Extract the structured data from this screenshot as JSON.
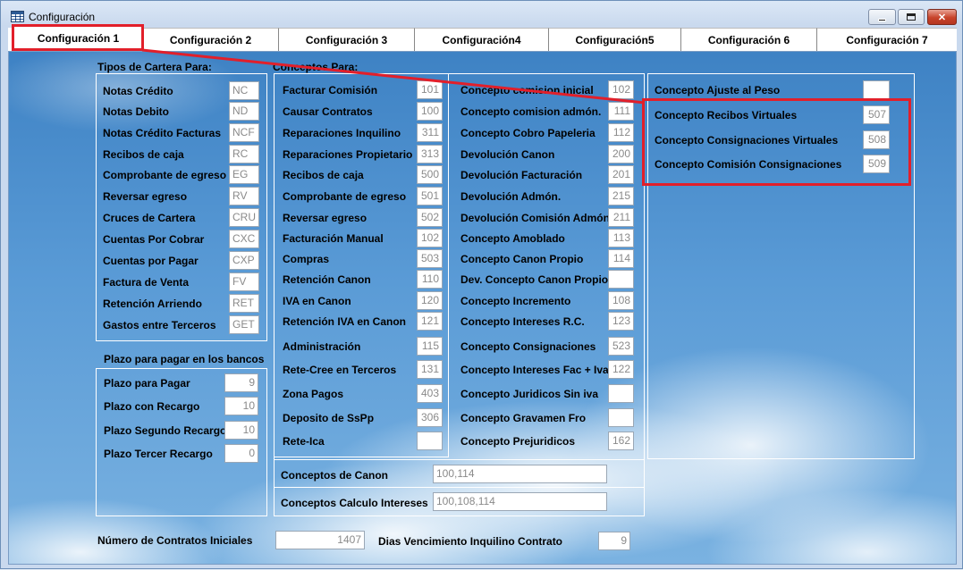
{
  "window": {
    "title": "Configuración"
  },
  "tabs": [
    "Configuración 1",
    "Configuración 2",
    "Configuración 3",
    "Configuración4",
    "Configuración5",
    "Configuración 6",
    "Configuración 7"
  ],
  "tipos_cartera": {
    "title": "Tipos de Cartera Para:",
    "rows": [
      {
        "label": "Notas Crédito",
        "value": "NC"
      },
      {
        "label": "Notas Debito",
        "value": "ND"
      },
      {
        "label": "Notas Crédito Facturas",
        "value": "NCF"
      },
      {
        "label": "Recibos de caja",
        "value": "RC"
      },
      {
        "label": "Comprobante de egreso",
        "value": "EG"
      },
      {
        "label": "Reversar egreso",
        "value": "RV"
      },
      {
        "label": "Cruces de Cartera",
        "value": "CRU"
      },
      {
        "label": "Cuentas Por Cobrar",
        "value": "CXC"
      },
      {
        "label": "Cuentas por Pagar",
        "value": "CXP"
      },
      {
        "label": "Factura de Venta",
        "value": "FV"
      },
      {
        "label": "Retención Arriendo",
        "value": "RET"
      },
      {
        "label": "Gastos entre Terceros",
        "value": "GET"
      }
    ]
  },
  "plazo": {
    "title": "Plazo para pagar en los bancos",
    "rows": [
      {
        "label": "Plazo para Pagar",
        "value": "9"
      },
      {
        "label": "Plazo con Recargo",
        "value": "10"
      },
      {
        "label": "Plazo Segundo Recargo",
        "value": "10"
      },
      {
        "label": "Plazo Tercer Recargo",
        "value": "0"
      }
    ]
  },
  "conceptos": {
    "title": "Conceptos Para:",
    "col1": [
      {
        "label": "Facturar Comisión",
        "value": "101"
      },
      {
        "label": "Causar Contratos",
        "value": "100"
      },
      {
        "label": "Reparaciones Inquilino",
        "value": "311"
      },
      {
        "label": "Reparaciones Propietario",
        "value": "313"
      },
      {
        "label": "Recibos de caja",
        "value": "500"
      },
      {
        "label": "Comprobante de egreso",
        "value": "501"
      },
      {
        "label": "Reversar egreso",
        "value": "502"
      },
      {
        "label": "Facturación Manual",
        "value": "102"
      },
      {
        "label": "Compras",
        "value": "503"
      },
      {
        "label": "Retención Canon",
        "value": "110"
      },
      {
        "label": "IVA en Canon",
        "value": "120"
      },
      {
        "label": "Retención IVA en Canon",
        "value": "121"
      },
      {
        "label": "Administración",
        "value": "115"
      },
      {
        "label": "Rete-Cree en Terceros",
        "value": "131"
      },
      {
        "label": "Zona Pagos",
        "value": "403"
      },
      {
        "label": "Deposito de SsPp",
        "value": "306"
      },
      {
        "label": "Rete-Ica",
        "value": ""
      }
    ],
    "col2": [
      {
        "label": "Concepto comision inicial",
        "value": "102"
      },
      {
        "label": "Concepto comision admón.",
        "value": "111"
      },
      {
        "label": "Concepto Cobro Papeleria",
        "value": "112"
      },
      {
        "label": "Devolución Canon",
        "value": "200"
      },
      {
        "label": "Devolución Facturación",
        "value": "201"
      },
      {
        "label": "Devolución Admón.",
        "value": "215"
      },
      {
        "label": "Devolución Comisión Admón.",
        "value": "211"
      },
      {
        "label": "Concepto Amoblado",
        "value": "113"
      },
      {
        "label": "Concepto Canon Propio",
        "value": "114"
      },
      {
        "label": "Dev. Concepto Canon Propio",
        "value": ""
      },
      {
        "label": "Concepto Incremento",
        "value": "108"
      },
      {
        "label": "Concepto Intereses R.C.",
        "value": "123"
      },
      {
        "label": "Concepto Consignaciones",
        "value": "523"
      },
      {
        "label": "Concepto Intereses Fac + Iva",
        "value": "122"
      },
      {
        "label": "Concepto Juridicos Sin iva",
        "value": ""
      },
      {
        "label": "Concepto Gravamen Fro",
        "value": ""
      },
      {
        "label": "Concepto Prejuridicos",
        "value": "162"
      }
    ],
    "canon": {
      "label": "Conceptos de Canon",
      "value": "100,114"
    },
    "intereses": {
      "label": "Conceptos Calculo Intereses",
      "value": "100,108,114"
    }
  },
  "col3": [
    {
      "label": "Concepto Ajuste al Peso",
      "value": ""
    },
    {
      "label": "Concepto Recibos Virtuales",
      "value": "507"
    },
    {
      "label": "Concepto Consignaciones Virtuales",
      "value": "508"
    },
    {
      "label": "Concepto Comisión Consignaciones",
      "value": "509"
    }
  ],
  "bottom": {
    "contratos": {
      "label": "Número de Contratos Iniciales",
      "value": "1407"
    },
    "dias": {
      "label": "Dias Vencimiento Inquilino Contrato",
      "value": "9"
    }
  },
  "colors": {
    "highlight": "#e21f2a",
    "sky": "#4d8fcf"
  }
}
